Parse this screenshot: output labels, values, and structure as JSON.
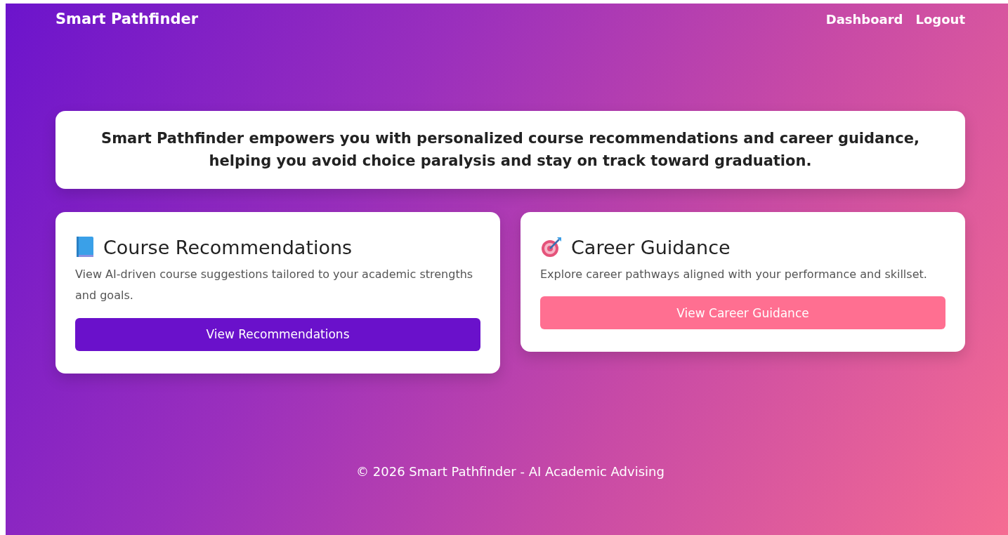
{
  "navbar": {
    "brand": "Smart Pathfinder",
    "links": [
      "Dashboard",
      "Logout"
    ]
  },
  "intro": {
    "text": "Smart Pathfinder empowers you with personalized course recommendations and career guidance, helping you avoid choice paralysis and stay on track toward graduation."
  },
  "cards": [
    {
      "kind": "book",
      "title": "Course Recommendations",
      "description": "View AI-driven course suggestions tailored to your academic strengths and goals.",
      "button": {
        "label": "View Recommendations",
        "kind": "primary"
      }
    },
    {
      "kind": "target",
      "title": "Career Guidance",
      "description": "Explore career pathways aligned with your performance and skillset.",
      "button": {
        "label": "View Career Guidance",
        "kind": "accent"
      }
    }
  ],
  "footer": {
    "text": "© 2026 Smart Pathfinder - AI Academic Advising"
  }
}
